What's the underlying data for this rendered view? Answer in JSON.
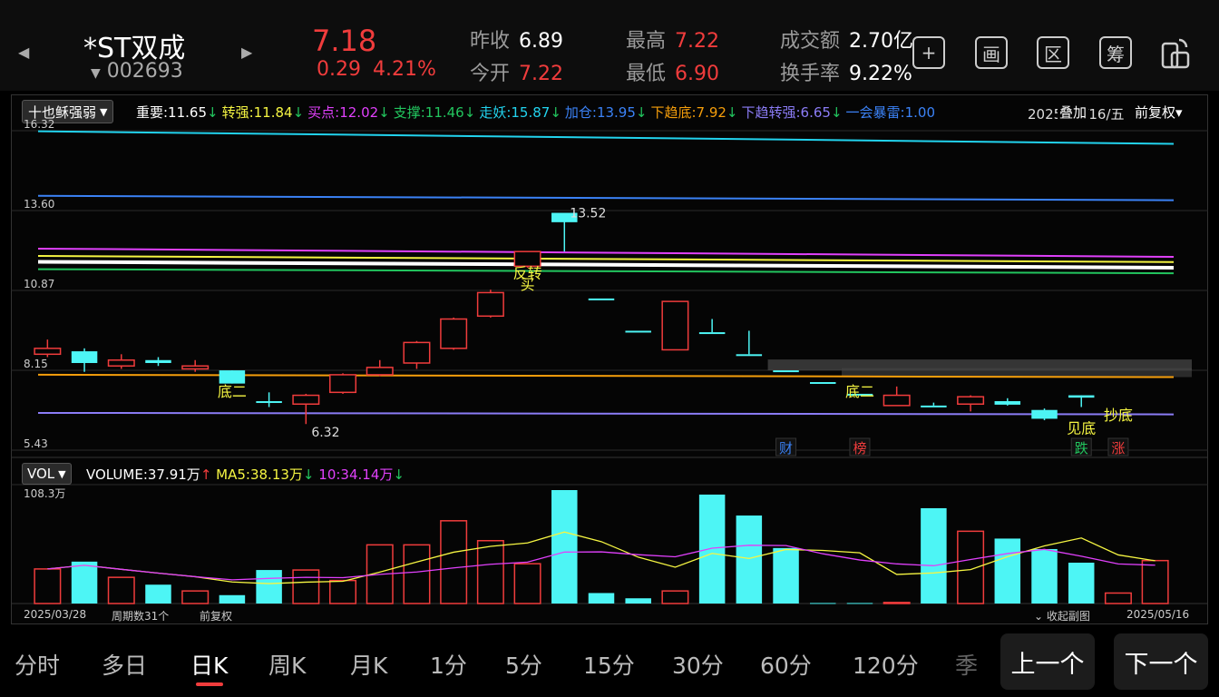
{
  "header": {
    "name": "*ST双成",
    "code": "002693",
    "price": "7.18",
    "change": "0.29",
    "change_pct": "4.21%",
    "quotes": [
      {
        "label": "昨收",
        "value": "6.89",
        "color": "#ffffff"
      },
      {
        "label": "今开",
        "value": "7.22",
        "color": "#f03c3c"
      },
      {
        "label": "最高",
        "value": "7.22",
        "color": "#f03c3c"
      },
      {
        "label": "最低",
        "value": "6.90",
        "color": "#f03c3c"
      },
      {
        "label": "成交额",
        "value": "2.70亿",
        "color": "#ffffff"
      },
      {
        "label": "换手率",
        "value": "9.22%",
        "color": "#ffffff"
      }
    ],
    "tools": [
      "+",
      "画",
      "区",
      "筹"
    ]
  },
  "indicator": {
    "selector": "十也稣强弱",
    "items": [
      {
        "text": "重要:11.65",
        "arrow": "↓",
        "color": "#ffffff",
        "arrow_color": "#22c55e"
      },
      {
        "text": "转强:11.84",
        "arrow": "↓",
        "color": "#f5f542",
        "arrow_color": "#22c55e"
      },
      {
        "text": "买点:12.02",
        "arrow": "↓",
        "color": "#e040fb",
        "arrow_color": "#22c55e"
      },
      {
        "text": "支撑:11.46",
        "arrow": "↓",
        "color": "#22c55e",
        "arrow_color": "#22c55e"
      },
      {
        "text": "走妖:15.87",
        "arrow": "↓",
        "color": "#22d3ee",
        "arrow_color": "#22c55e"
      },
      {
        "text": "加仓:13.95",
        "arrow": "↓",
        "color": "#3b82f6",
        "arrow_color": "#22c55e"
      },
      {
        "text": "下趋底:7.92",
        "arrow": "↓",
        "color": "#f59e0b",
        "arrow_color": "#22c55e"
      },
      {
        "text": "下趋转强:6.65",
        "arrow": "↓",
        "color": "#8b7cf6",
        "arrow_color": "#22c55e"
      },
      {
        "text": "一会暴雷:1.00",
        "arrow": "",
        "color": "#3b82f6",
        "arrow_color": "#22c55e"
      }
    ],
    "date_info": "2025/05/16/五",
    "overlay": "叠加",
    "adjust": "前复权"
  },
  "price_axis": [
    "16.32",
    "13.60",
    "10.87",
    "8.15",
    "5.43"
  ],
  "chart_data": {
    "type": "candlestick",
    "y_range": [
      5.43,
      16.32
    ],
    "candles": [
      {
        "o": 8.7,
        "c": 8.9,
        "h": 9.2,
        "l": 8.6,
        "up": true
      },
      {
        "o": 8.8,
        "c": 8.4,
        "h": 8.9,
        "l": 8.1,
        "up": false
      },
      {
        "o": 8.3,
        "c": 8.5,
        "h": 8.7,
        "l": 8.2,
        "up": true
      },
      {
        "o": 8.5,
        "c": 8.4,
        "h": 8.6,
        "l": 8.3,
        "up": false
      },
      {
        "o": 8.2,
        "c": 8.3,
        "h": 8.5,
        "l": 8.1,
        "up": true
      },
      {
        "o": 8.15,
        "c": 7.7,
        "h": 8.15,
        "l": 7.7,
        "up": false
      },
      {
        "o": 7.1,
        "c": 7.05,
        "h": 7.4,
        "l": 6.9,
        "up": false
      },
      {
        "o": 7.0,
        "c": 7.3,
        "h": 7.35,
        "l": 6.32,
        "up": true
      },
      {
        "o": 7.4,
        "c": 8.0,
        "h": 8.05,
        "l": 7.35,
        "up": true
      },
      {
        "o": 8.0,
        "c": 8.25,
        "h": 8.5,
        "l": 7.95,
        "up": true
      },
      {
        "o": 8.4,
        "c": 9.1,
        "h": 9.15,
        "l": 8.2,
        "up": true
      },
      {
        "o": 8.9,
        "c": 9.9,
        "h": 9.95,
        "l": 8.85,
        "up": true
      },
      {
        "o": 10.0,
        "c": 10.8,
        "h": 10.9,
        "l": 9.95,
        "up": true
      },
      {
        "o": 11.7,
        "c": 12.2,
        "h": 12.2,
        "l": 11.65,
        "up": true
      },
      {
        "o": 13.52,
        "c": 13.2,
        "h": 13.52,
        "l": 12.2,
        "up": false
      },
      {
        "o": 10.6,
        "c": 10.6,
        "h": 10.6,
        "l": 10.6,
        "up": false
      },
      {
        "o": 9.5,
        "c": 9.5,
        "h": 9.5,
        "l": 9.5,
        "up": false
      },
      {
        "o": 8.85,
        "c": 10.5,
        "h": 10.5,
        "l": 8.85,
        "up": true
      },
      {
        "o": 9.45,
        "c": 9.45,
        "h": 9.9,
        "l": 9.45,
        "up": false
      },
      {
        "o": 8.7,
        "c": 8.7,
        "h": 9.5,
        "l": 8.7,
        "up": false
      },
      {
        "o": 8.15,
        "c": 8.15,
        "h": 8.15,
        "l": 8.15,
        "up": false
      },
      {
        "o": 7.75,
        "c": 7.75,
        "h": 7.75,
        "l": 7.75,
        "up": false
      },
      {
        "o": 7.35,
        "c": 7.35,
        "h": 7.35,
        "l": 7.35,
        "up": false
      },
      {
        "o": 6.95,
        "c": 7.3,
        "h": 7.6,
        "l": 6.95,
        "up": true
      },
      {
        "o": 6.95,
        "c": 6.95,
        "h": 7.05,
        "l": 6.95,
        "up": false
      },
      {
        "o": 7.0,
        "c": 7.25,
        "h": 7.3,
        "l": 6.75,
        "up": true
      },
      {
        "o": 7.1,
        "c": 6.98,
        "h": 7.2,
        "l": 6.95,
        "up": false
      },
      {
        "o": 6.8,
        "c": 6.5,
        "h": 6.85,
        "l": 6.45,
        "up": false
      },
      {
        "o": 7.3,
        "c": 7.22,
        "h": 7.3,
        "l": 6.9,
        "up": false
      }
    ],
    "price_labels": [
      {
        "i": 14,
        "value": "13.52"
      },
      {
        "i": 7,
        "value": "6.32"
      }
    ],
    "lines": [
      {
        "name": "走妖",
        "color": "#22d3ee",
        "start": 16.3,
        "end": 15.87
      },
      {
        "name": "加仓",
        "color": "#3b82f6",
        "start": 14.1,
        "end": 13.95
      },
      {
        "name": "买点",
        "color": "#e040fb",
        "start": 12.3,
        "end": 12.02
      },
      {
        "name": "转强",
        "color": "#f5f542",
        "start": 12.05,
        "end": 11.84
      },
      {
        "name": "重要",
        "color": "#ffffff",
        "start": 11.85,
        "end": 11.65
      },
      {
        "name": "支撑",
        "color": "#22c55e",
        "start": 11.6,
        "end": 11.46
      },
      {
        "name": "下趋底",
        "color": "#f59e0b",
        "start": 8.0,
        "end": 7.92
      },
      {
        "name": "下趋转强",
        "color": "#8b7cf6",
        "start": 6.7,
        "end": 6.65
      }
    ],
    "signals": [
      {
        "i": 5,
        "text": "底二",
        "color": "#f5f542",
        "price": 7.25
      },
      {
        "i": 13,
        "text": "反转",
        "color": "#f5f542",
        "price": 11.3
      },
      {
        "i": 13,
        "text": "买",
        "color": "#f5f542",
        "price": 10.9
      },
      {
        "i": 22,
        "text": "底二",
        "color": "#f5f542",
        "price": 7.25
      },
      {
        "i": 28,
        "text": "见底",
        "color": "#f5f542",
        "price": 6.0
      },
      {
        "i": 29,
        "text": "抄底",
        "color": "#f5f542",
        "price": 6.45
      }
    ],
    "event_tags": [
      {
        "i": 20,
        "text": "财",
        "color": "#3b82f6"
      },
      {
        "i": 22,
        "text": "榜",
        "color": "#f03c3c"
      },
      {
        "i": 28,
        "text": "跌",
        "color": "#22c55e"
      },
      {
        "i": 29,
        "text": "涨",
        "color": "#f03c3c"
      }
    ],
    "volume": {
      "max": 108.3,
      "bars": [
        33,
        40,
        25,
        18,
        12,
        8,
        32,
        32,
        22,
        56,
        56,
        79,
        60,
        38,
        108.3,
        10,
        5,
        12,
        104,
        84,
        53,
        0.5,
        0.5,
        1,
        91,
        69,
        62,
        52,
        39,
        10,
        41
      ]
    }
  },
  "volume_panel": {
    "selector": "VOL",
    "vol": "VOLUME:37.91万",
    "vol_arrow": "↑",
    "ma5": "MA5:38.13万",
    "ma5_arrow": "↓",
    "ma10": "10:34.14万",
    "ma10_arrow": "↓",
    "max_label": "108.3万"
  },
  "footer": {
    "start_date": "2025/03/28",
    "period_count": "周期数31个",
    "adjust": "前复权",
    "collapse": "收起副图",
    "end_date": "2025/05/16"
  },
  "tabs": [
    {
      "label": "分时",
      "active": false
    },
    {
      "label": "多日",
      "active": false
    },
    {
      "label": "日K",
      "active": true
    },
    {
      "label": "周K",
      "active": false
    },
    {
      "label": "月K",
      "active": false
    },
    {
      "label": "1分",
      "active": false
    },
    {
      "label": "5分",
      "active": false
    },
    {
      "label": "15分",
      "active": false
    },
    {
      "label": "30分",
      "active": false
    },
    {
      "label": "60分",
      "active": false
    },
    {
      "label": "120分",
      "active": false
    },
    {
      "label": "季",
      "active": false
    }
  ],
  "nav": {
    "prev": "上一个",
    "next": "下一个"
  }
}
